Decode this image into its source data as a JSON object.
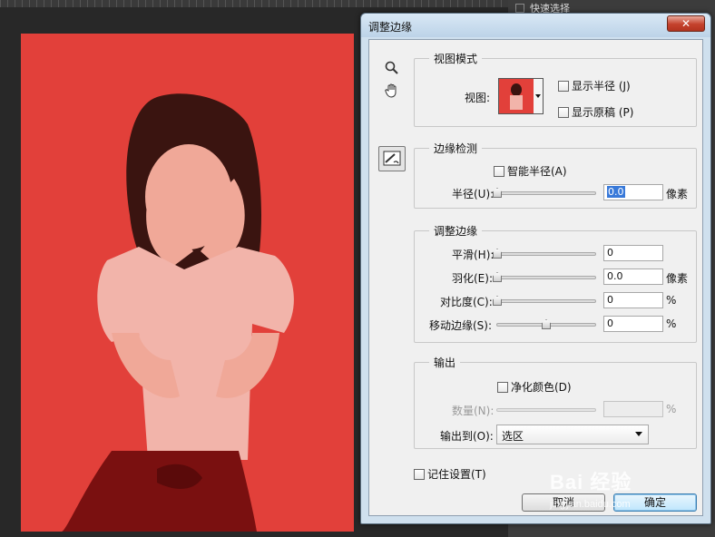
{
  "panel": {
    "row_label": "快速选择"
  },
  "dialog": {
    "title": "调整边缘",
    "close_label": "✕",
    "view_mode": {
      "title": "视图模式",
      "view_label": "视图:",
      "show_radius": "显示半径 (J)",
      "show_original": "显示原稿 (P)"
    },
    "edge_detection": {
      "title": "边缘检测",
      "smart_radius": "智能半径(A)",
      "radius_label": "半径(U):",
      "radius_value": "0.0",
      "radius_unit": "像素"
    },
    "adjust_edge": {
      "title": "调整边缘",
      "smooth_label": "平滑(H):",
      "smooth_value": "0",
      "feather_label": "羽化(E):",
      "feather_value": "0.0",
      "feather_unit": "像素",
      "contrast_label": "对比度(C):",
      "contrast_value": "0",
      "contrast_unit": "%",
      "shift_label": "移动边缘(S):",
      "shift_value": "0",
      "shift_unit": "%"
    },
    "output": {
      "title": "输出",
      "decontaminate": "净化颜色(D)",
      "amount_label": "数量(N):",
      "amount_value": "",
      "amount_unit": "%",
      "output_to_label": "输出到(O):",
      "output_to_value": "选区"
    },
    "remember": "记住设置(T)",
    "cancel_label": "取消",
    "ok_label": "确定"
  },
  "watermark": {
    "text": "Bai 经验",
    "sub": "jingyan.baidu.com"
  },
  "colors": {
    "overlay_red": "#e2403a",
    "dialog_frame": "#cfe0ee",
    "close_red": "#c4412c"
  },
  "icons": [
    "zoom-icon",
    "hand-icon",
    "refine-radius-icon",
    "dropdown-arrow-icon"
  ]
}
